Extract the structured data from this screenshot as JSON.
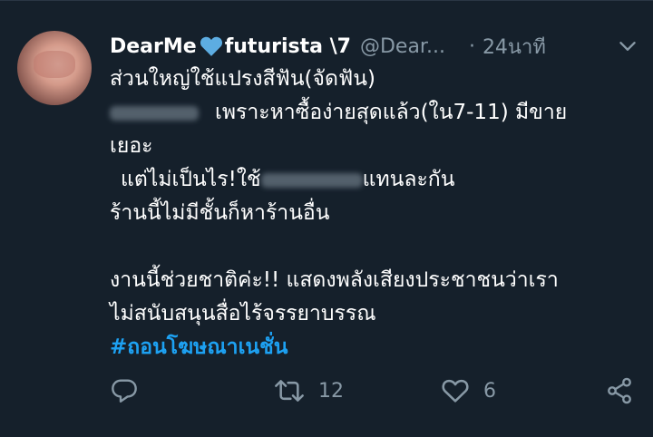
{
  "tweet": {
    "display_name_before": "DearMe",
    "display_name_after": "futurista \\7",
    "handle": "@Dear...",
    "separator": "·",
    "time": "24นาที",
    "lines": {
      "l1": "ส่วนใหญ่ใช้แปรงสีฟัน(จัดฟัน)",
      "l2": "เพราะหาซื้อง่ายสุดแล้ว(ใน7-11) มีขาย",
      "l3": "เยอะ",
      "l4a": "แต่ไม่เป็นไร!ใช้",
      "l4b": "แทนละกัน",
      "l5": "ร้านนี้ไม่มีชั้นก็หาร้านอื่น",
      "l6": "งานนี้ช่วยชาติค่ะ!! แสดงพลังเสียงประชาชนว่าเรา",
      "l7": "ไม่สนับสนุนสื่อไร้จรรยาบรรณ"
    },
    "hashtag": "#ถอนโฆษณาเนชั่น"
  },
  "actions": {
    "reply_icon": "reply-icon",
    "retweet_icon": "retweet-icon",
    "retweet_count": "12",
    "like_icon": "heart-outline-icon",
    "like_count": "6",
    "share_icon": "share-icon"
  },
  "colors": {
    "background": "#15202b",
    "text": "#ffffff",
    "secondary": "#8899a6",
    "link": "#1da1f2",
    "heart_emoji": "#5dade2"
  }
}
